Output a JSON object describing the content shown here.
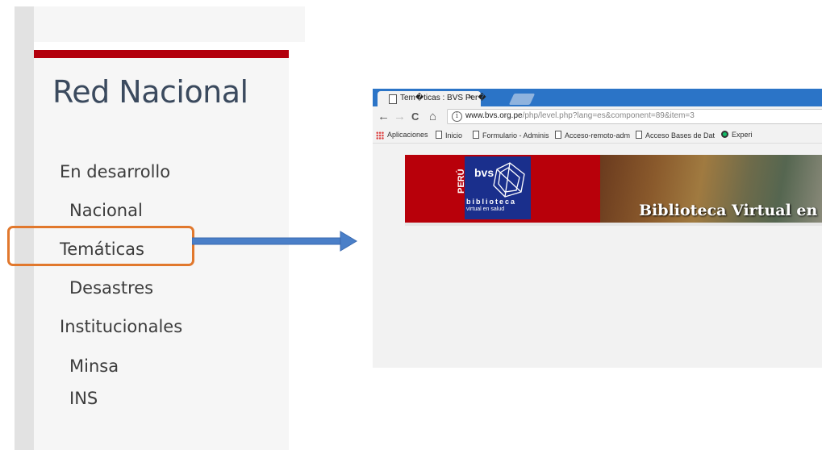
{
  "sidebar": {
    "title": "Red Nacional",
    "items": [
      {
        "label": "En desarrollo"
      },
      {
        "label": "Nacional"
      },
      {
        "label": "Temáticas"
      },
      {
        "label": "Desastres"
      },
      {
        "label": "Institucionales"
      },
      {
        "label": "Minsa"
      },
      {
        "label": "INS"
      }
    ],
    "highlighted_item": "Temáticas",
    "accent_color": "#b3000d",
    "highlight_color": "#e1782d"
  },
  "arrow": {
    "icon": "right-arrow-icon",
    "color": "#4a7fc8"
  },
  "browser": {
    "tab": {
      "title": "Tem�ticas : BVS Per�",
      "close": "×"
    },
    "toolbar": {
      "back": "←",
      "forward": "→",
      "reload": "C",
      "home": "⌂"
    },
    "url": {
      "host": "www.bvs.org.pe",
      "path": "/php/level.php?lang=es&component=89&item=3"
    },
    "bookmarks": [
      {
        "label": "Aplicaciones"
      },
      {
        "label": "Inicio"
      },
      {
        "label": "Formulario - Adminis"
      },
      {
        "label": "Acceso-remoto-adm"
      },
      {
        "label": "Acceso Bases de Dat"
      },
      {
        "label": "Experi"
      }
    ],
    "banner": {
      "country": "PERÚ",
      "logo_text": "bvs",
      "biblioteca": "biblioteca",
      "virtual_en_salud": "virtual en salud",
      "headline": "Biblioteca Virtual en Sa"
    }
  }
}
